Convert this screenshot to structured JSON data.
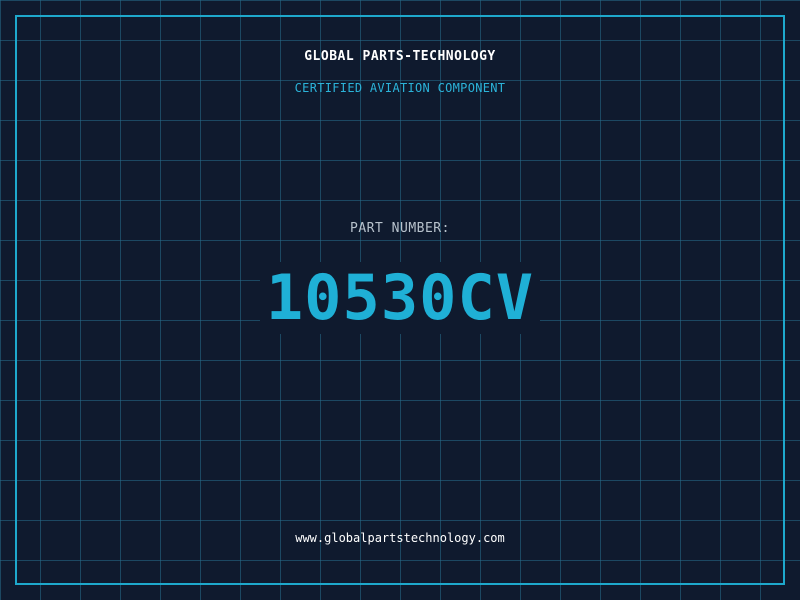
{
  "badge": {
    "company": "GLOBAL PARTS-TECHNOLOGY",
    "subtitle": "CERTIFIED AVIATION COMPONENT",
    "part_label": "PART NUMBER:",
    "part_number": "10530CV",
    "website": "www.globalpartstechnology.com"
  },
  "colors": {
    "background": "#0f1a2e",
    "grid": "#266e8c",
    "frame": "#1ea8cc",
    "accent": "#1fb0d6",
    "label": "#b8c2cc",
    "text": "#ffffff"
  }
}
